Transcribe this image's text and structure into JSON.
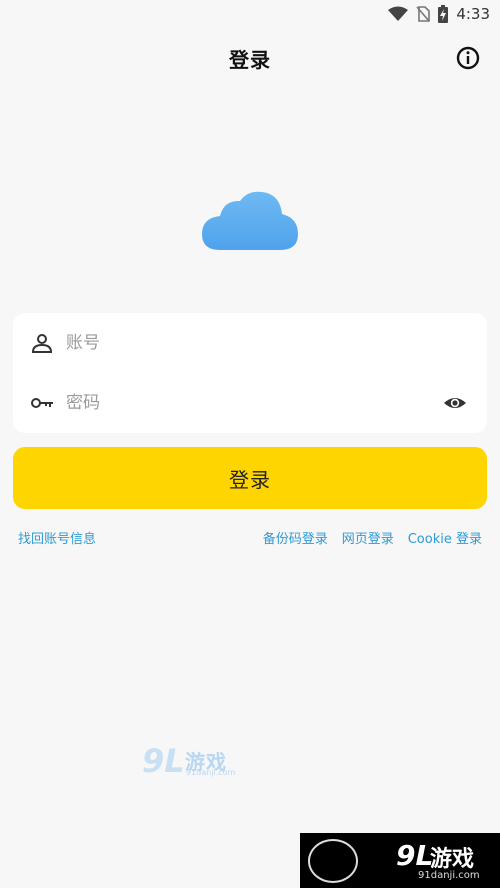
{
  "status_bar": {
    "time": "4:33"
  },
  "header": {
    "title": "登录"
  },
  "form": {
    "account_placeholder": "账号",
    "password_placeholder": "密码",
    "login_label": "登录"
  },
  "links": {
    "recover": "找回账号信息",
    "backup_code": "备份码登录",
    "web": "网页登录",
    "cookie": "Cookie 登录"
  },
  "watermark": {
    "mid_num": "9L",
    "mid_text": "游戏",
    "mid_sub": "91danji.com",
    "bar_num": "9L",
    "bar_text": "游戏",
    "bar_sub": "91danji.com"
  },
  "colors": {
    "accent": "#ffd500",
    "link": "#2e9bd6",
    "background": "#f7f7f7",
    "cloud": "#5aaef0"
  }
}
